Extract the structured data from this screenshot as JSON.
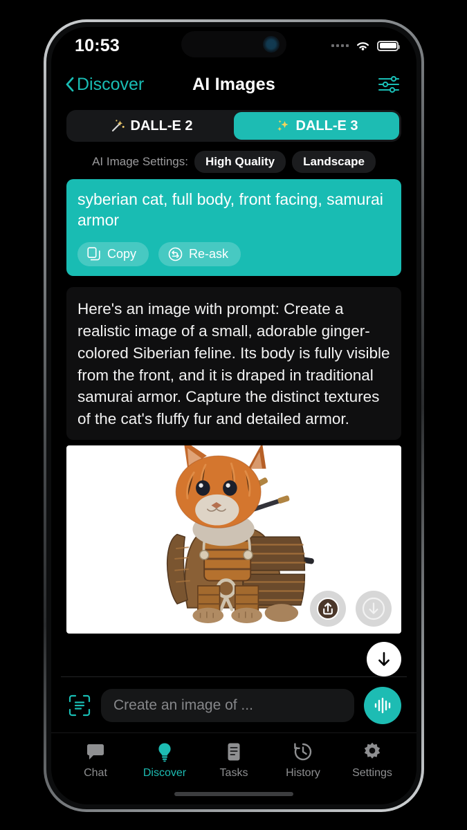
{
  "theme": {
    "accent": "#1dbcb3",
    "background": "#000000",
    "bubble_ai_bg": "#0f0f10",
    "bubble_user_bg": "#19bcb3",
    "chip_bg": "#1b1c1e",
    "muted_text": "#8e8f91"
  },
  "status_bar": {
    "time": "10:53",
    "cellular_icon": "cellular-dots-icon",
    "wifi_icon": "wifi-icon",
    "battery_icon": "battery-full-icon"
  },
  "nav": {
    "back_icon": "chevron-left-icon",
    "back_label": "Discover",
    "title": "AI Images",
    "filter_icon": "sliders-icon"
  },
  "model_tabs": [
    {
      "label": "DALL-E 2",
      "icon": "magic-wand-icon",
      "active": false
    },
    {
      "label": "DALL-E 3",
      "icon": "sparkles-icon",
      "active": true
    }
  ],
  "image_settings": {
    "label": "AI Image Settings:",
    "chips": [
      {
        "label": "High Quality"
      },
      {
        "label": "Landscape"
      }
    ]
  },
  "conversation": {
    "user_message": {
      "text": "syberian cat, full body, front facing, samurai armor",
      "actions": [
        {
          "label": "Copy",
          "icon": "copy-icon"
        },
        {
          "label": "Re-ask",
          "icon": "refresh-icon"
        }
      ]
    },
    "assistant_message": {
      "text": "Here's an image with prompt: Create a realistic image of a small, adorable ginger-colored Siberian feline. Its body is fully visible from the front, and it is draped in traditional samurai armor. Capture the distinct textures of the cat's fluffy fur and detailed armor.",
      "image_alt": "ginger kitten wearing brown samurai armor with two katana swords on white background",
      "image_actions": [
        {
          "icon": "share-icon"
        },
        {
          "icon": "download-icon"
        }
      ]
    },
    "scroll_to_bottom_icon": "arrow-down-icon"
  },
  "composer": {
    "scan_icon": "scan-text-icon",
    "placeholder": "Create an image of ...",
    "value": "",
    "mic_icon": "voice-waveform-icon"
  },
  "tabbar": [
    {
      "label": "Chat",
      "icon": "chat-bubble-icon",
      "active": false
    },
    {
      "label": "Discover",
      "icon": "lightbulb-icon",
      "active": true
    },
    {
      "label": "Tasks",
      "icon": "document-icon",
      "active": false
    },
    {
      "label": "History",
      "icon": "clock-rewind-icon",
      "active": false
    },
    {
      "label": "Settings",
      "icon": "gear-icon",
      "active": false
    }
  ]
}
